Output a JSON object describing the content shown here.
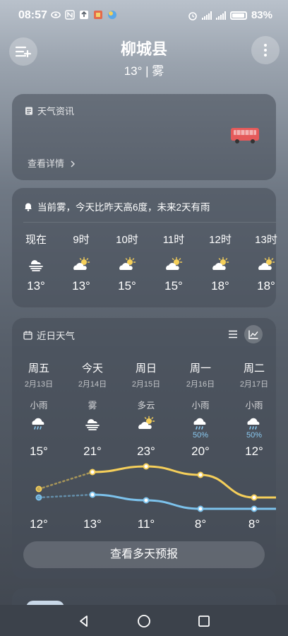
{
  "status_bar": {
    "time": "08:57",
    "battery": "83%",
    "battery_level": 83
  },
  "header": {
    "city": "柳城县",
    "current": "13° | 雾"
  },
  "news": {
    "title": "天气资讯",
    "detail": "查看详情"
  },
  "hourly": {
    "summary": "当前雾，今天比昨天高6度，未来2天有雨",
    "items": [
      {
        "label": "现在",
        "temp": "13°",
        "icon": "fog-icon"
      },
      {
        "label": "9时",
        "temp": "13°",
        "icon": "partly-sunny-icon"
      },
      {
        "label": "10时",
        "temp": "15°",
        "icon": "partly-sunny-icon"
      },
      {
        "label": "11时",
        "temp": "15°",
        "icon": "partly-sunny-icon"
      },
      {
        "label": "12时",
        "temp": "18°",
        "icon": "partly-sunny-icon"
      },
      {
        "label": "13时",
        "temp": "18°",
        "icon": "partly-sunny-icon"
      }
    ]
  },
  "daily": {
    "title": "近日天气",
    "more_label": "查看多天预报",
    "days": [
      {
        "name": "周五",
        "date": "2月13日",
        "cond": "小雨",
        "pct": "",
        "hi": "15°",
        "lo": "12°",
        "icon": "rain-cloud-icon"
      },
      {
        "name": "今天",
        "date": "2月14日",
        "cond": "雾",
        "pct": "",
        "hi": "21°",
        "lo": "13°",
        "icon": "fog-icon"
      },
      {
        "name": "周日",
        "date": "2月15日",
        "cond": "多云",
        "pct": "",
        "hi": "23°",
        "lo": "11°",
        "icon": "partly-sunny-icon"
      },
      {
        "name": "周一",
        "date": "2月16日",
        "cond": "小雨",
        "pct": "50%",
        "hi": "20°",
        "lo": "8°",
        "icon": "rain-cloud-icon"
      },
      {
        "name": "周二",
        "date": "2月17日",
        "cond": "小雨",
        "pct": "50%",
        "hi": "12°",
        "lo": "8°",
        "icon": "rain-cloud-icon"
      }
    ],
    "hi_values": [
      15,
      21,
      23,
      20,
      12
    ],
    "lo_values": [
      12,
      13,
      11,
      8,
      8
    ],
    "hi_color": "#f5cf5a",
    "lo_color": "#7cc2ec"
  }
}
